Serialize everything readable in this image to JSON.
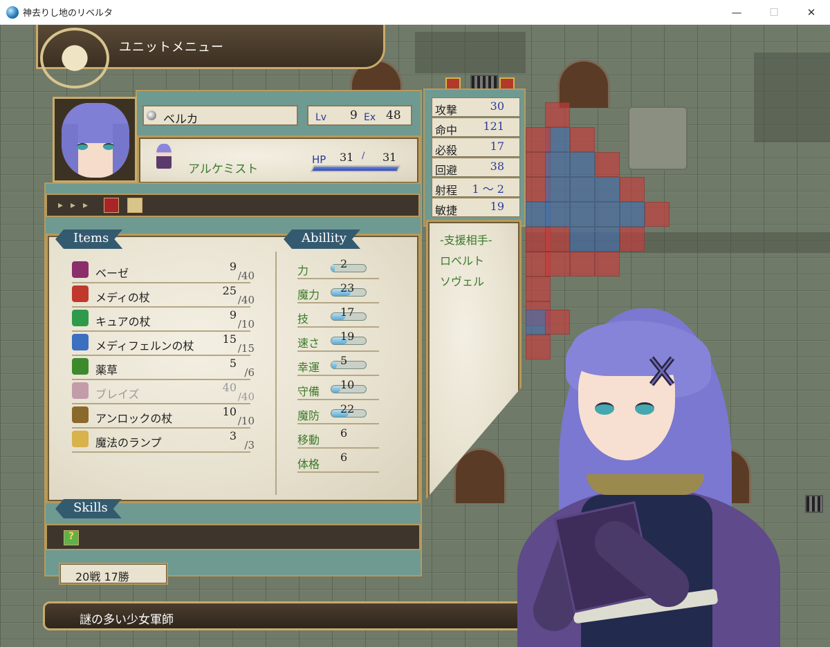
{
  "window": {
    "title": "神去りし地のリベルタ",
    "minimize": "—",
    "maximize": "☐",
    "close": "✕"
  },
  "menu": {
    "title": "ユニットメニュー"
  },
  "unit": {
    "name": "ベルカ",
    "lv_label": "Lv",
    "lv": "9",
    "ex_label": "Ex",
    "ex": "48",
    "class": "アルケミスト",
    "hp_label": "HP",
    "hp_current": "31",
    "hp_sep": "/",
    "hp_max": "31",
    "hp_fraction": 1.0
  },
  "sections": {
    "items": "Items",
    "ability": "Abillity",
    "skills": "Skills"
  },
  "items": [
    {
      "name": "ベーゼ",
      "current": "9",
      "max": "/40",
      "icon": "tome-icon",
      "dim": false
    },
    {
      "name": "メディの杖",
      "current": "25",
      "max": "/40",
      "icon": "red-staff-icon",
      "dim": false
    },
    {
      "name": "キュアの杖",
      "current": "9",
      "max": "/10",
      "icon": "green-staff-icon",
      "dim": false
    },
    {
      "name": "メディフェルンの杖",
      "current": "15",
      "max": "/15",
      "icon": "blue-staff-icon",
      "dim": false
    },
    {
      "name": "薬草",
      "current": "5",
      "max": "/6",
      "icon": "herb-icon",
      "dim": false
    },
    {
      "name": "ブレイズ",
      "current": "40",
      "max": "/40",
      "icon": "tome-icon",
      "dim": true
    },
    {
      "name": "アンロックの杖",
      "current": "10",
      "max": "/10",
      "icon": "unlock-staff-icon",
      "dim": false
    },
    {
      "name": "魔法のランプ",
      "current": "3",
      "max": "/3",
      "icon": "lamp-icon",
      "dim": false
    }
  ],
  "abilities": [
    {
      "label": "力",
      "value": "2",
      "gauge": 0.1
    },
    {
      "label": "魔力",
      "value": "23",
      "gauge": 0.55
    },
    {
      "label": "技",
      "value": "17",
      "gauge": 0.4
    },
    {
      "label": "速さ",
      "value": "19",
      "gauge": 0.45
    },
    {
      "label": "幸運",
      "value": "5",
      "gauge": 0.15
    },
    {
      "label": "守備",
      "value": "10",
      "gauge": 0.25
    },
    {
      "label": "魔防",
      "value": "22",
      "gauge": 0.5
    },
    {
      "label": "移動",
      "value": "6",
      "gauge": null
    },
    {
      "label": "体格",
      "value": "6",
      "gauge": null
    }
  ],
  "stats": [
    {
      "label": "攻撃",
      "value": "30"
    },
    {
      "label": "命中",
      "value": "121"
    },
    {
      "label": "必殺",
      "value": "17"
    },
    {
      "label": "回避",
      "value": "38"
    },
    {
      "label": "射程",
      "value": "1 ～ 2"
    },
    {
      "label": "敏捷",
      "value": "19"
    }
  ],
  "support": {
    "header": "-支援相手-",
    "partners": [
      "ロベルト",
      "ソヴェル"
    ]
  },
  "record": "20戦 17勝",
  "description": "謎の多い少女軍師",
  "colors": {
    "accent_gold": "#b89a5a",
    "teal": "#6f9a92",
    "label_green": "#3b7a2a",
    "value_blue": "#2b3a9a"
  }
}
